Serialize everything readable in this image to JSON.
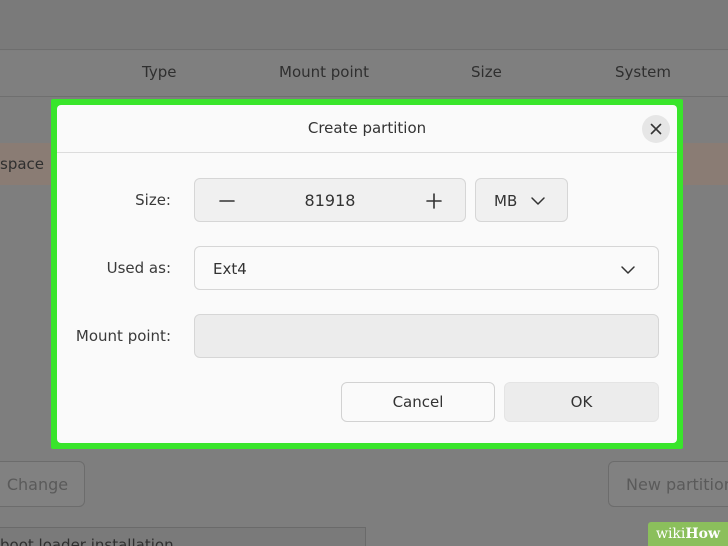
{
  "background": {
    "columns": [
      "Type",
      "Mount point",
      "Size",
      "System"
    ],
    "row_label": "space",
    "change_button": "Change",
    "new_partition_button": "New partition",
    "bottom_text": "boot loader installation"
  },
  "dialog": {
    "title": "Create partition",
    "close_icon": "close-icon",
    "size": {
      "label": "Size:",
      "value": "81918",
      "unit": "MB"
    },
    "used_as": {
      "label": "Used as:",
      "value": "Ext4"
    },
    "mount_point": {
      "label": "Mount point:",
      "value": ""
    },
    "cancel_label": "Cancel",
    "ok_label": "OK"
  },
  "highlight_color": "#39e52b",
  "watermark": {
    "part1": "wiki",
    "part2": "How"
  }
}
